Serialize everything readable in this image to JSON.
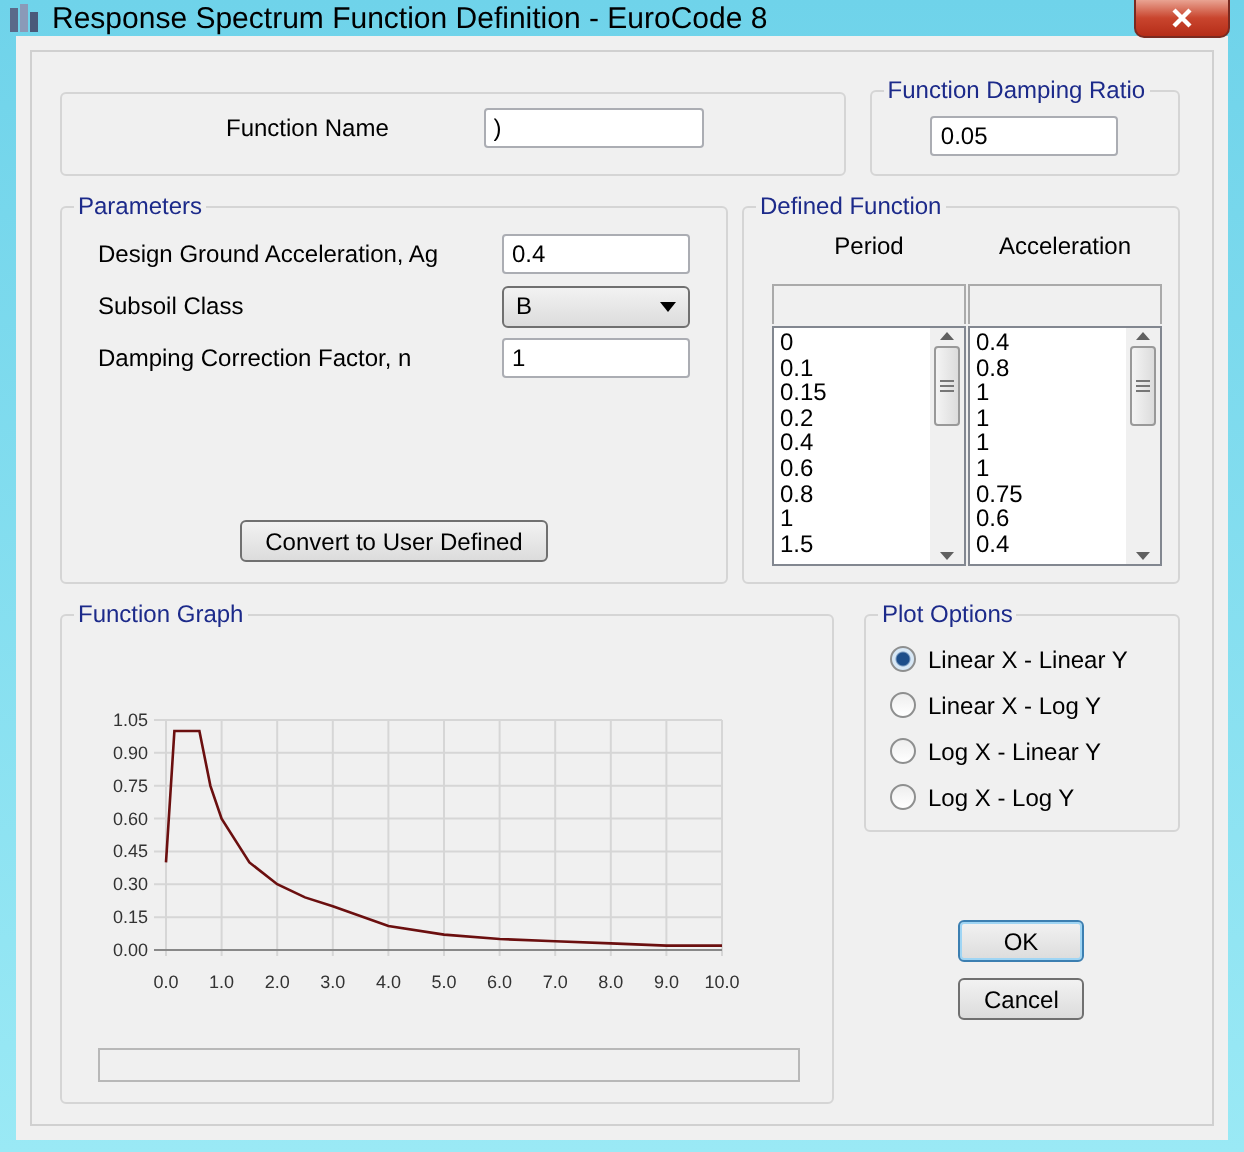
{
  "window": {
    "title": "Response Spectrum Function Definition - EuroCode 8"
  },
  "function_name": {
    "label": "Function Name",
    "value": ")"
  },
  "damping": {
    "title": "Function Damping Ratio",
    "value": "0.05"
  },
  "parameters": {
    "title": "Parameters",
    "fields": [
      {
        "kind": "text",
        "label": "Design Ground Acceleration, Ag",
        "value": "0.4"
      },
      {
        "kind": "dropdown",
        "label": "Subsoil Class",
        "value": "B"
      },
      {
        "kind": "text",
        "label": "Damping Correction Factor, n",
        "value": "1"
      }
    ],
    "button": "Convert to User Defined"
  },
  "defined_function": {
    "title": "Defined Function",
    "columns": [
      {
        "header": "Period",
        "values": [
          "0",
          "0.1",
          "0.15",
          "0.2",
          "0.4",
          "0.6",
          "0.8",
          "1",
          "1.5"
        ]
      },
      {
        "header": "Acceleration",
        "values": [
          "0.4",
          "0.8",
          "1",
          "1",
          "1",
          "1",
          "0.75",
          "0.6",
          "0.4"
        ]
      }
    ]
  },
  "function_graph": {
    "title": "Function Graph",
    "chart_data": {
      "type": "line",
      "x": [
        0,
        0.1,
        0.15,
        0.6,
        0.8,
        1,
        1.5,
        2,
        2.5,
        3,
        4,
        5,
        6,
        7,
        8,
        9,
        10
      ],
      "series": [
        {
          "color": "#6b0f0f",
          "values": [
            0.4,
            0.8,
            1,
            1,
            0.75,
            0.6,
            0.4,
            0.3,
            0.24,
            0.2,
            0.11,
            0.07,
            0.05,
            0.04,
            0.03,
            0.02,
            0.02
          ]
        }
      ],
      "xlim": [
        0,
        10
      ],
      "ylim": [
        0,
        1.05
      ],
      "grid": true,
      "xticks": [
        {
          "value": 0,
          "label": "0.0"
        },
        {
          "value": 1,
          "label": "1.0"
        },
        {
          "value": 2,
          "label": "2.0"
        },
        {
          "value": 3,
          "label": "3.0"
        },
        {
          "value": 4,
          "label": "4.0"
        },
        {
          "value": 5,
          "label": "5.0"
        },
        {
          "value": 6,
          "label": "6.0"
        },
        {
          "value": 7,
          "label": "7.0"
        },
        {
          "value": 8,
          "label": "8.0"
        },
        {
          "value": 9,
          "label": "9.0"
        },
        {
          "value": 10,
          "label": "10.0"
        }
      ],
      "yticks": [
        {
          "value": 0,
          "label": "0.00"
        },
        {
          "value": 0.15,
          "label": "0.15"
        },
        {
          "value": 0.3,
          "label": "0.30"
        },
        {
          "value": 0.45,
          "label": "0.45"
        },
        {
          "value": 0.6,
          "label": "0.60"
        },
        {
          "value": 0.75,
          "label": "0.75"
        },
        {
          "value": 0.9,
          "label": "0.90"
        },
        {
          "value": 1.05,
          "label": "1.05"
        }
      ]
    }
  },
  "plot_options": {
    "title": "Plot Options",
    "options": [
      {
        "label": "Linear X - Linear Y",
        "selected": true
      },
      {
        "label": "Linear X - Log Y",
        "selected": false
      },
      {
        "label": "Log X - Linear Y",
        "selected": false
      },
      {
        "label": "Log X - Log Y",
        "selected": false
      }
    ]
  },
  "buttons": [
    {
      "label": "OK",
      "default": true
    },
    {
      "label": "Cancel",
      "default": false
    }
  ]
}
